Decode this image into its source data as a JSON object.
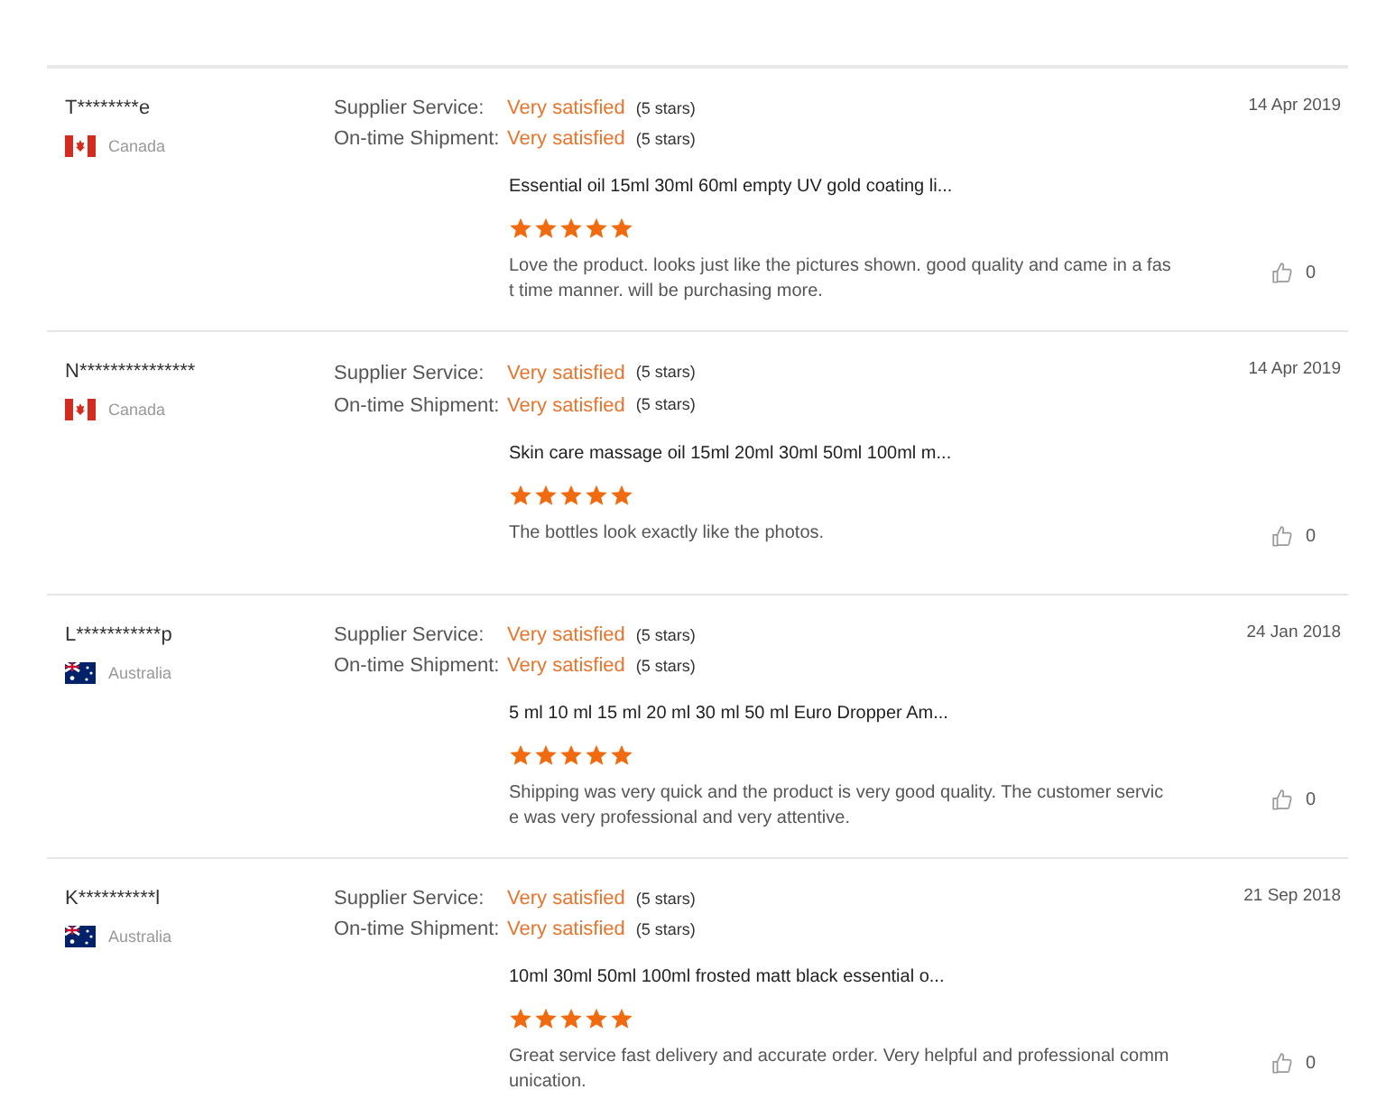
{
  "reviews": [
    {
      "reviewer": "T********e",
      "country": "Canada",
      "kind": "ca",
      "ratings": [
        {
          "label": "Supplier Service:",
          "value": "Very satisfied",
          "stars_text": "(5 stars)"
        },
        {
          "label": "On-time Shipment:",
          "value": "Very satisfied",
          "stars_text": "(5 stars)"
        }
      ],
      "date": "14 Apr 2019",
      "product": "Essential oil 15ml 30ml 60ml empty UV gold coating li...",
      "stars": 5,
      "text": "Love the product. looks just like the pictures shown. good quality and came in a fast time manner. will be purchasing more.",
      "likes": "0"
    },
    {
      "reviewer": "N***************",
      "country": "Canada",
      "kind": "ca",
      "ratings": [
        {
          "label": "Supplier Service:",
          "value": "Very satisfied",
          "stars_text": "(5 stars)"
        },
        {
          "label": "On-time Shipment:",
          "value": "Very satisfied",
          "stars_text": "(5 stars)"
        }
      ],
      "date": "14 Apr 2019",
      "product": "Skin care massage oil 15ml 20ml 30ml 50ml 100ml m...",
      "stars": 5,
      "text": "The bottles look exactly like the photos.",
      "likes": "0"
    },
    {
      "reviewer": "L***********p",
      "country": "Australia",
      "kind": "au",
      "ratings": [
        {
          "label": "Supplier Service:",
          "value": "Very satisfied",
          "stars_text": "(5 stars)"
        },
        {
          "label": "On-time Shipment:",
          "value": "Very satisfied",
          "stars_text": "(5 stars)"
        }
      ],
      "date": "24 Jan 2018",
      "product": "5 ml 10 ml 15 ml 20 ml 30 ml 50 ml Euro Dropper Am...",
      "stars": 5,
      "text": "Shipping was very quick and the product is very good quality. The customer service was very professional and very attentive.",
      "likes": "0"
    },
    {
      "reviewer": "K**********l",
      "country": "Australia",
      "kind": "au",
      "ratings": [
        {
          "label": "Supplier Service:",
          "value": "Very satisfied",
          "stars_text": "(5 stars)"
        },
        {
          "label": "On-time Shipment:",
          "value": "Very satisfied",
          "stars_text": "(5 stars)"
        }
      ],
      "date": "21 Sep 2018",
      "product": "10ml 30ml 50ml 100ml frosted matt black essential o...",
      "stars": 5,
      "text": "Great service fast delivery and accurate order. Very helpful and professional communication.",
      "likes": "0"
    }
  ]
}
